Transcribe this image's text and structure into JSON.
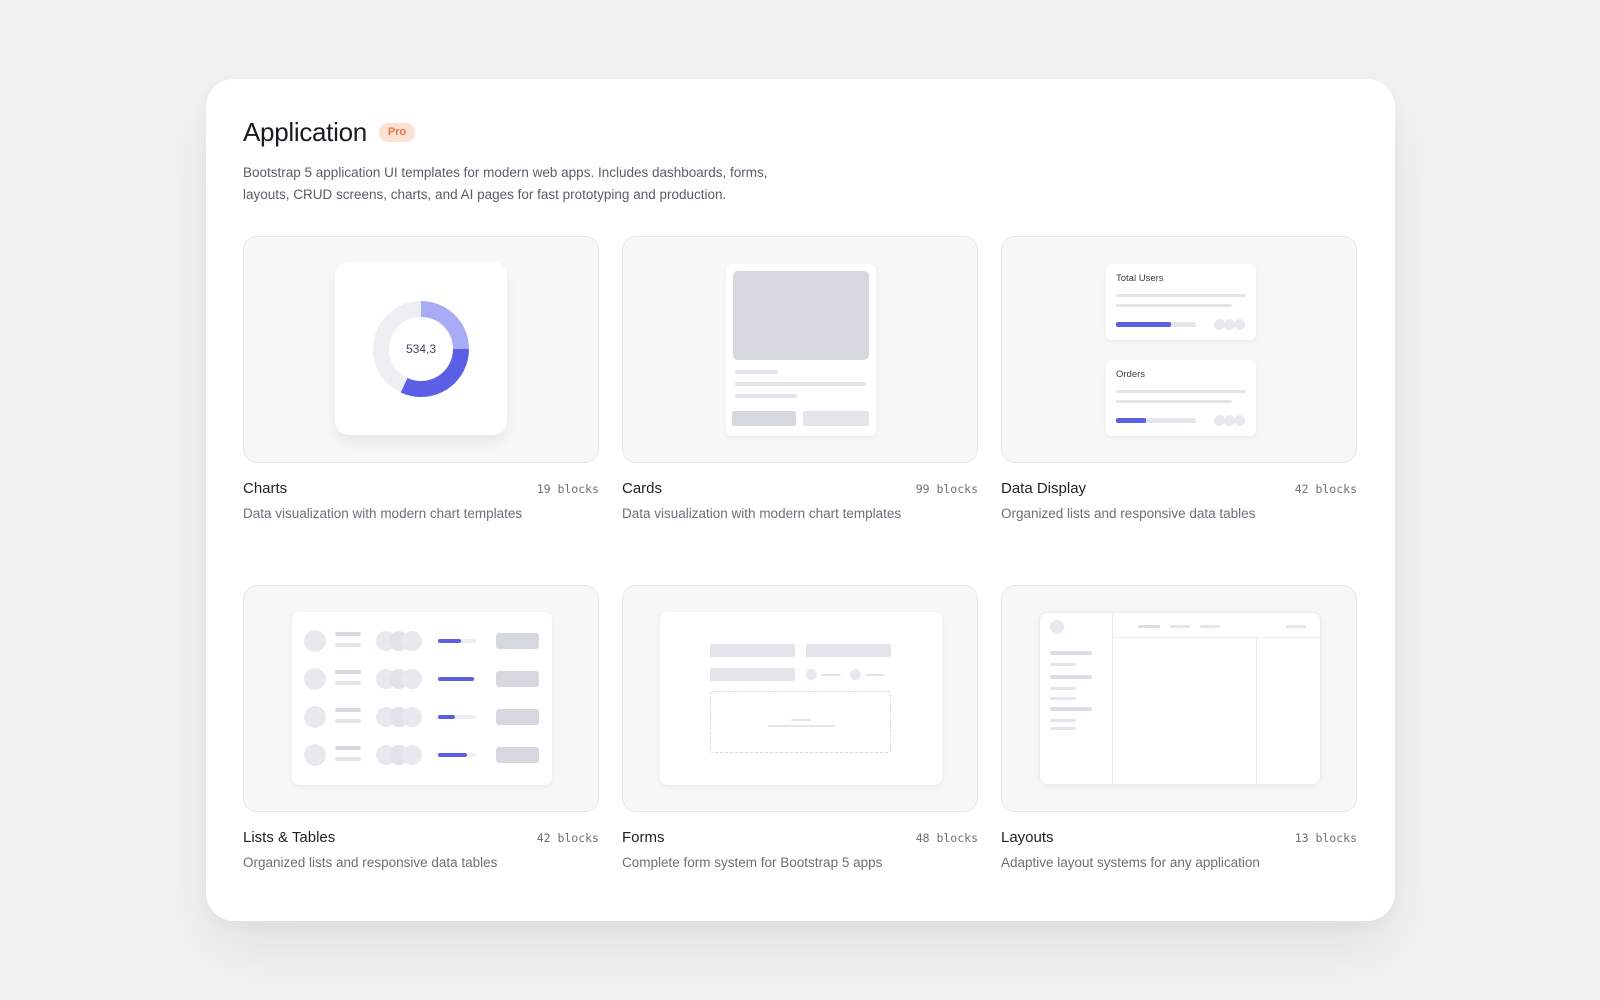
{
  "header": {
    "title": "Application",
    "badge": "Pro",
    "description": "Bootstrap 5 application UI templates for modern web apps. Includes dashboards, forms, layouts, CRUD screens, charts, and AI pages for fast prototyping and production."
  },
  "colors": {
    "accent": "#5b5fe6",
    "accent_light": "#a9acf5",
    "badge_text": "#e8734a",
    "badge_bg": "#fde2d3"
  },
  "cards": [
    {
      "name": "Charts",
      "count": "19 blocks",
      "description": "Data visualization with modern chart templates",
      "preview": {
        "donut_value": "534,3",
        "donut_fraction": 0.56
      }
    },
    {
      "name": "Cards",
      "count": "99 blocks",
      "description": "Data visualization with modern chart templates"
    },
    {
      "name": "Data Display",
      "count": "42 blocks",
      "description": "Organized lists and responsive data tables",
      "preview": {
        "stat1_label": "Total Users",
        "stat2_label": "Orders",
        "stat1_progress": 0.69,
        "stat2_progress": 0.38
      }
    },
    {
      "name": "Lists & Tables",
      "count": "42 blocks",
      "description": "Organized lists and responsive data tables",
      "preview": {
        "progress": [
          0.6,
          0.95,
          0.45,
          0.75
        ]
      }
    },
    {
      "name": "Forms",
      "count": "48 blocks",
      "description": "Complete form system for Bootstrap 5 apps"
    },
    {
      "name": "Layouts",
      "count": "13 blocks",
      "description": "Adaptive layout systems for any application"
    }
  ]
}
